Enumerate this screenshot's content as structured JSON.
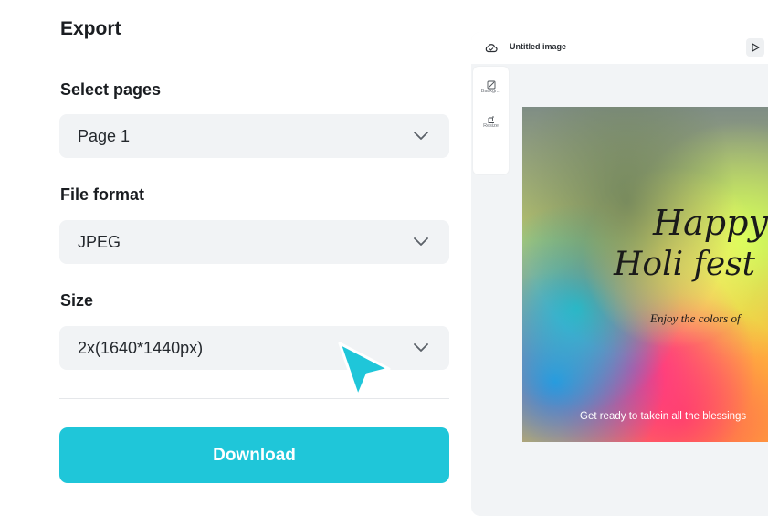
{
  "export": {
    "title": "Export",
    "select_pages": {
      "label": "Select pages",
      "value": "Page 1"
    },
    "file_format": {
      "label": "File format",
      "value": "JPEG"
    },
    "size": {
      "label": "Size",
      "value": "2x(1640*1440px)"
    },
    "download_label": "Download"
  },
  "preview": {
    "doc_title": "Untitled image",
    "tools": [
      {
        "icon": "background-icon",
        "label": "Backgr..."
      },
      {
        "icon": "resize-icon",
        "label": "Resize"
      }
    ],
    "canvas": {
      "line1": "Happy",
      "line2": "Holi fest",
      "line3": "Enjoy the colors of",
      "line4": "Get ready to takein all the blessings"
    }
  },
  "colors": {
    "accent": "#1fc6d9",
    "field_bg": "#f1f3f5",
    "cursor": "#1fc6d9"
  }
}
